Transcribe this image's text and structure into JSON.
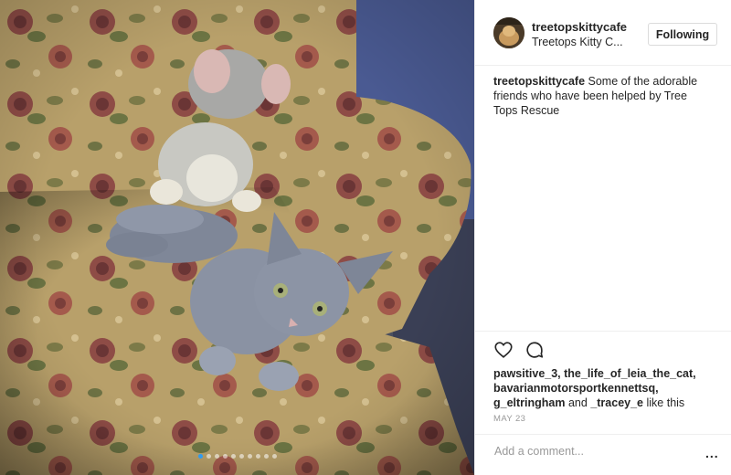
{
  "post": {
    "username": "treetopskittycafe",
    "location": "Treetops Kitty C...",
    "follow_label": "Following",
    "caption_username": "treetopskittycafe",
    "caption_text": " Some of the adorable friends who have been helped by Tree Tops Rescue",
    "likes_names": "pawsitive_3, the_life_of_leia_the_cat, bavarianmotorsportkennettsq, g_eltringham",
    "likes_and": " and ",
    "likes_last": "_tracey_e",
    "likes_suffix": " like this",
    "date": "MAY 23",
    "comment_placeholder": "Add a comment...",
    "more_label": "..."
  },
  "carousel": {
    "count": 10,
    "active_index": 0
  },
  "icons": [
    "heart-icon",
    "comment-icon"
  ],
  "colors": {
    "active_dot": "#2f9bf0",
    "text": "#262626",
    "muted": "#999999"
  }
}
